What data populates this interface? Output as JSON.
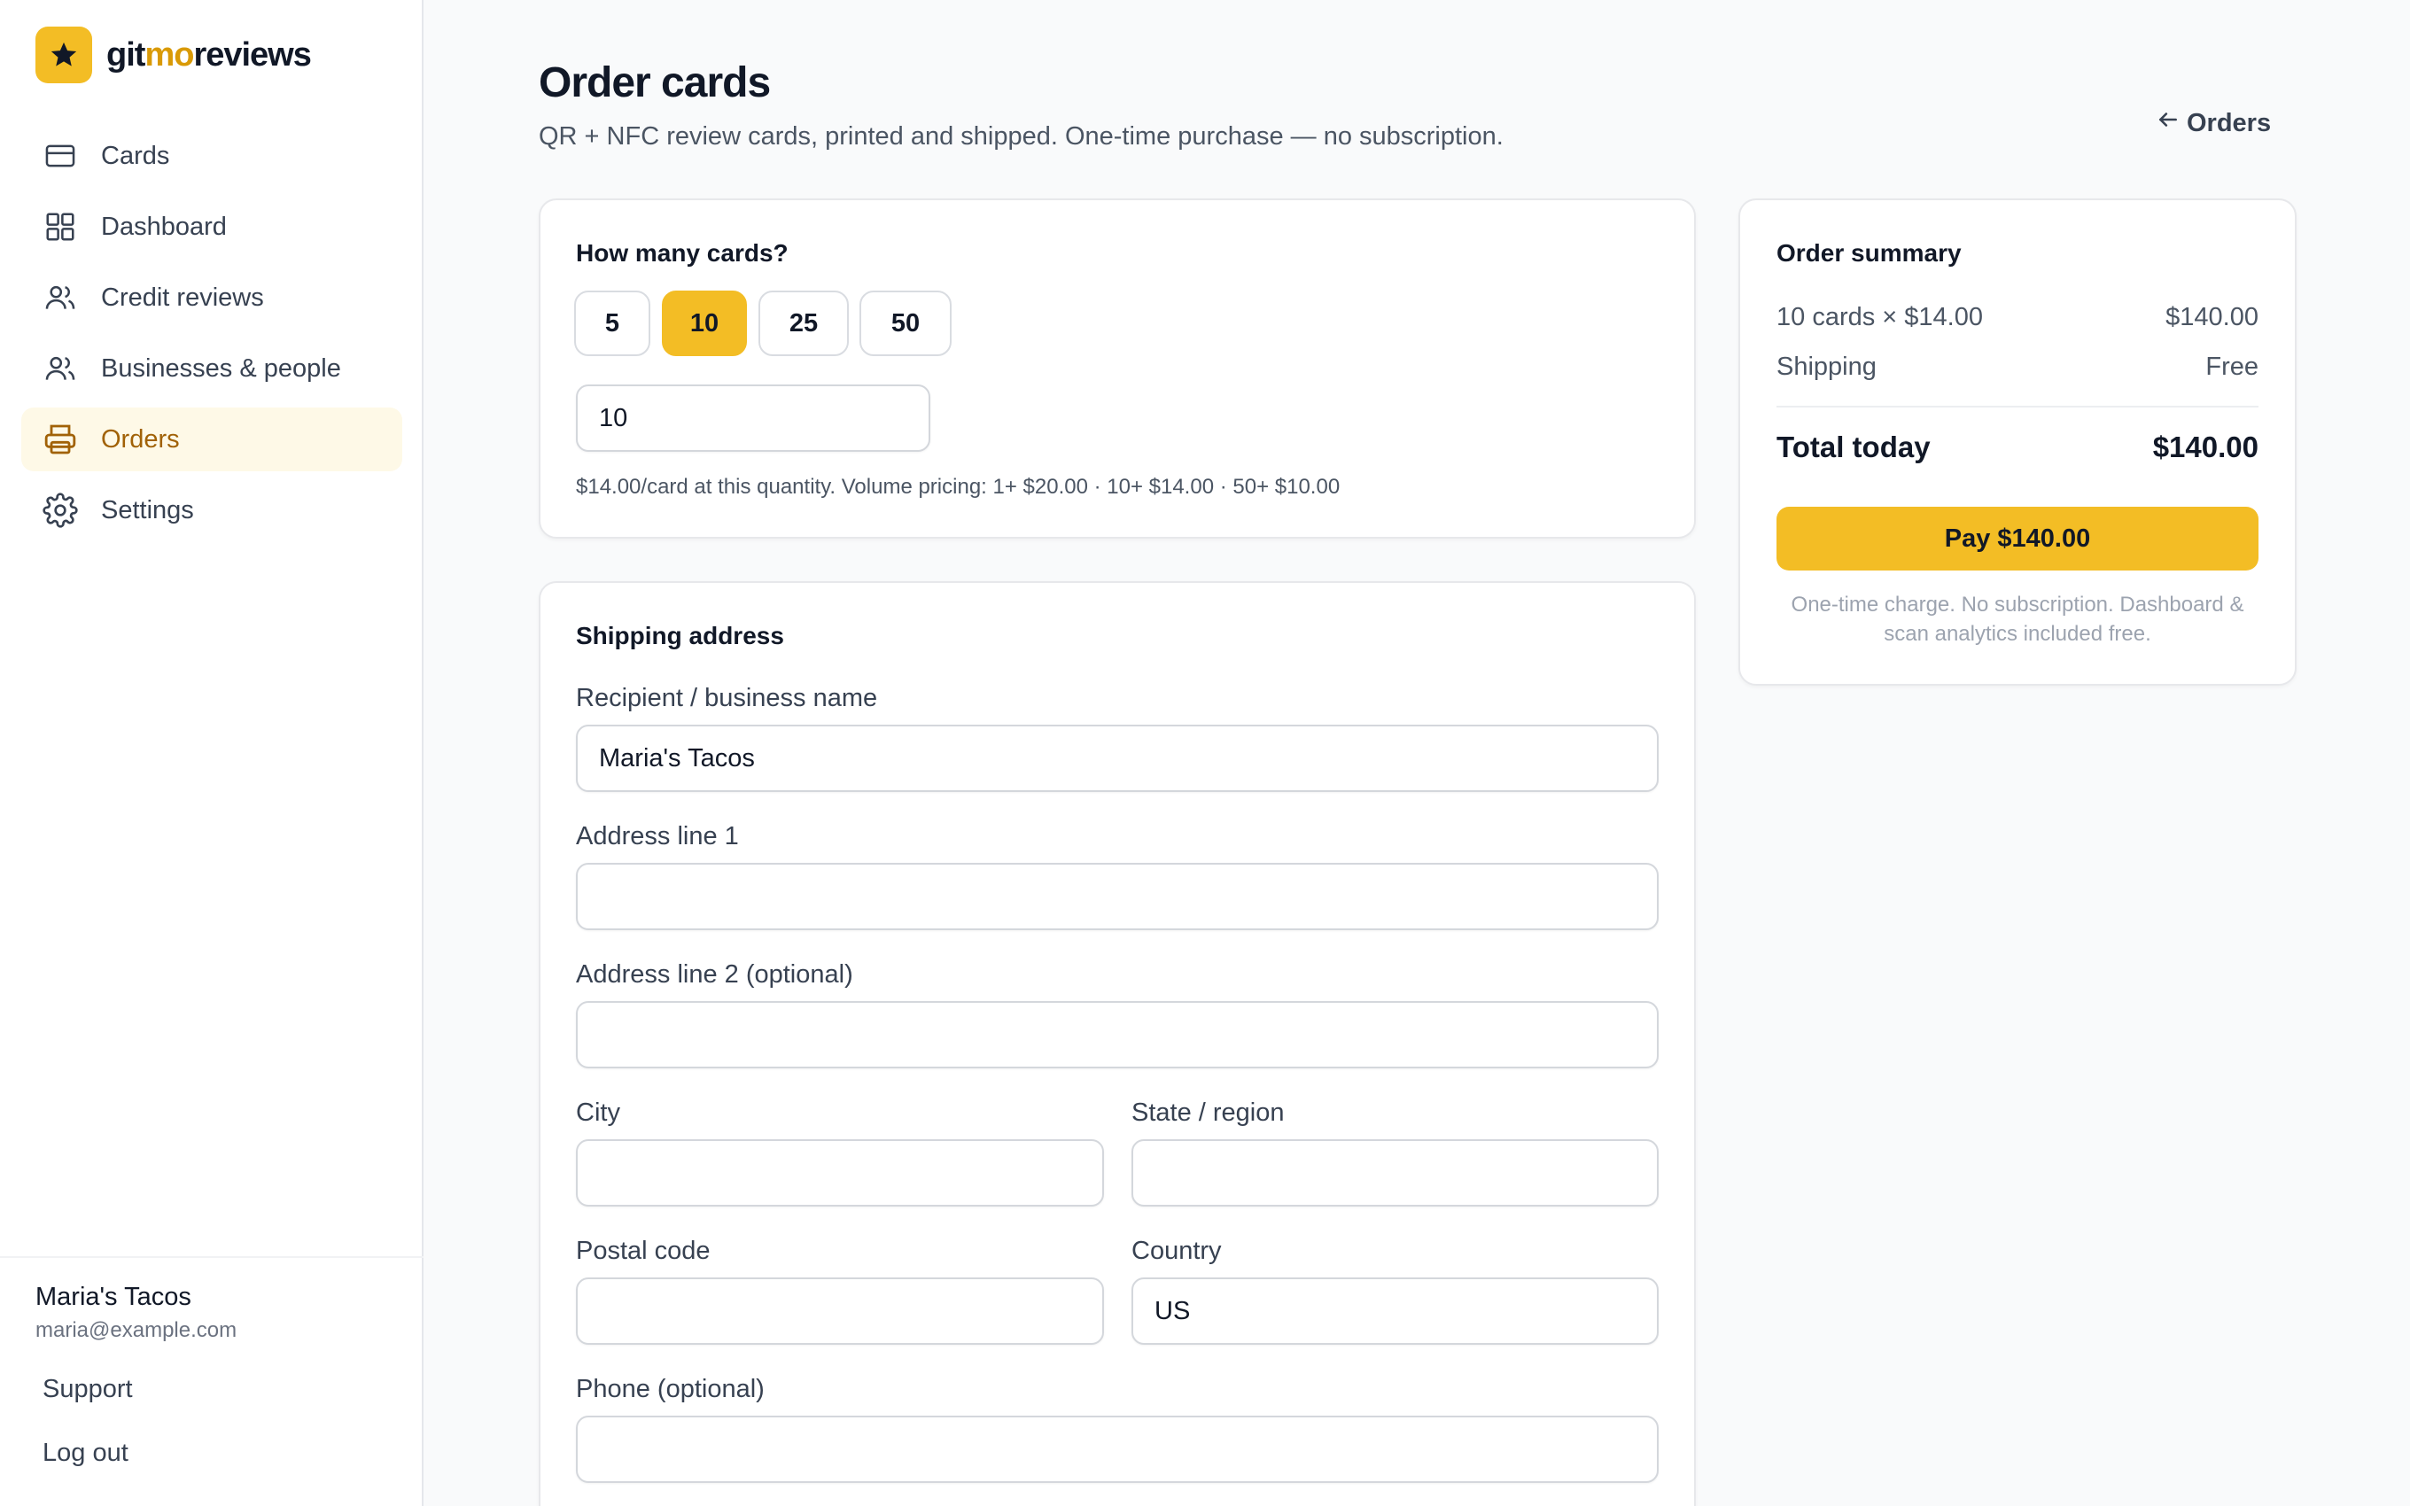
{
  "brand": {
    "part1": "git",
    "part2": "mo",
    "part3": "reviews"
  },
  "nav": [
    {
      "label": "Cards",
      "icon": "credit-card-icon"
    },
    {
      "label": "Dashboard",
      "icon": "grid-icon"
    },
    {
      "label": "Credit reviews",
      "icon": "users-icon"
    },
    {
      "label": "Businesses & people",
      "icon": "users-icon"
    },
    {
      "label": "Orders",
      "icon": "printer-icon",
      "active": true
    },
    {
      "label": "Settings",
      "icon": "gear-icon"
    }
  ],
  "user": {
    "name": "Maria's Tacos",
    "email": "maria@example.com"
  },
  "footer_links": {
    "support": "Support",
    "logout": "Log out"
  },
  "header": {
    "title": "Order cards",
    "subtitle": "QR + NFC review cards, printed and shipped. One-time purchase — no subscription.",
    "back_label": "Orders"
  },
  "quantity": {
    "title": "How many cards?",
    "options": [
      "5",
      "10",
      "25",
      "50"
    ],
    "selected": "10",
    "input_value": "10",
    "hint": "$14.00/card at this quantity. Volume pricing: 1+ $20.00 · 10+ $14.00 · 50+ $10.00"
  },
  "shipping": {
    "title": "Shipping address",
    "fields": {
      "recipient": {
        "label": "Recipient / business name",
        "value": "Maria's Tacos"
      },
      "address1": {
        "label": "Address line 1",
        "value": ""
      },
      "address2": {
        "label": "Address line 2 (optional)",
        "value": ""
      },
      "city": {
        "label": "City",
        "value": ""
      },
      "state": {
        "label": "State / region",
        "value": ""
      },
      "postal": {
        "label": "Postal code",
        "value": ""
      },
      "country": {
        "label": "Country",
        "value": "US"
      },
      "phone": {
        "label": "Phone (optional)",
        "value": ""
      }
    }
  },
  "summary": {
    "title": "Order summary",
    "line_label": "10 cards × $14.00",
    "line_value": "$140.00",
    "shipping_label": "Shipping",
    "shipping_value": "Free",
    "total_label": "Total today",
    "total_value": "$140.00",
    "pay_label": "Pay $140.00",
    "note": "One-time charge. No subscription. Dashboard & scan analytics included free."
  },
  "colors": {
    "accent": "#f3bd25",
    "accent_text": "#a16207",
    "active_bg": "#fef9e7"
  }
}
